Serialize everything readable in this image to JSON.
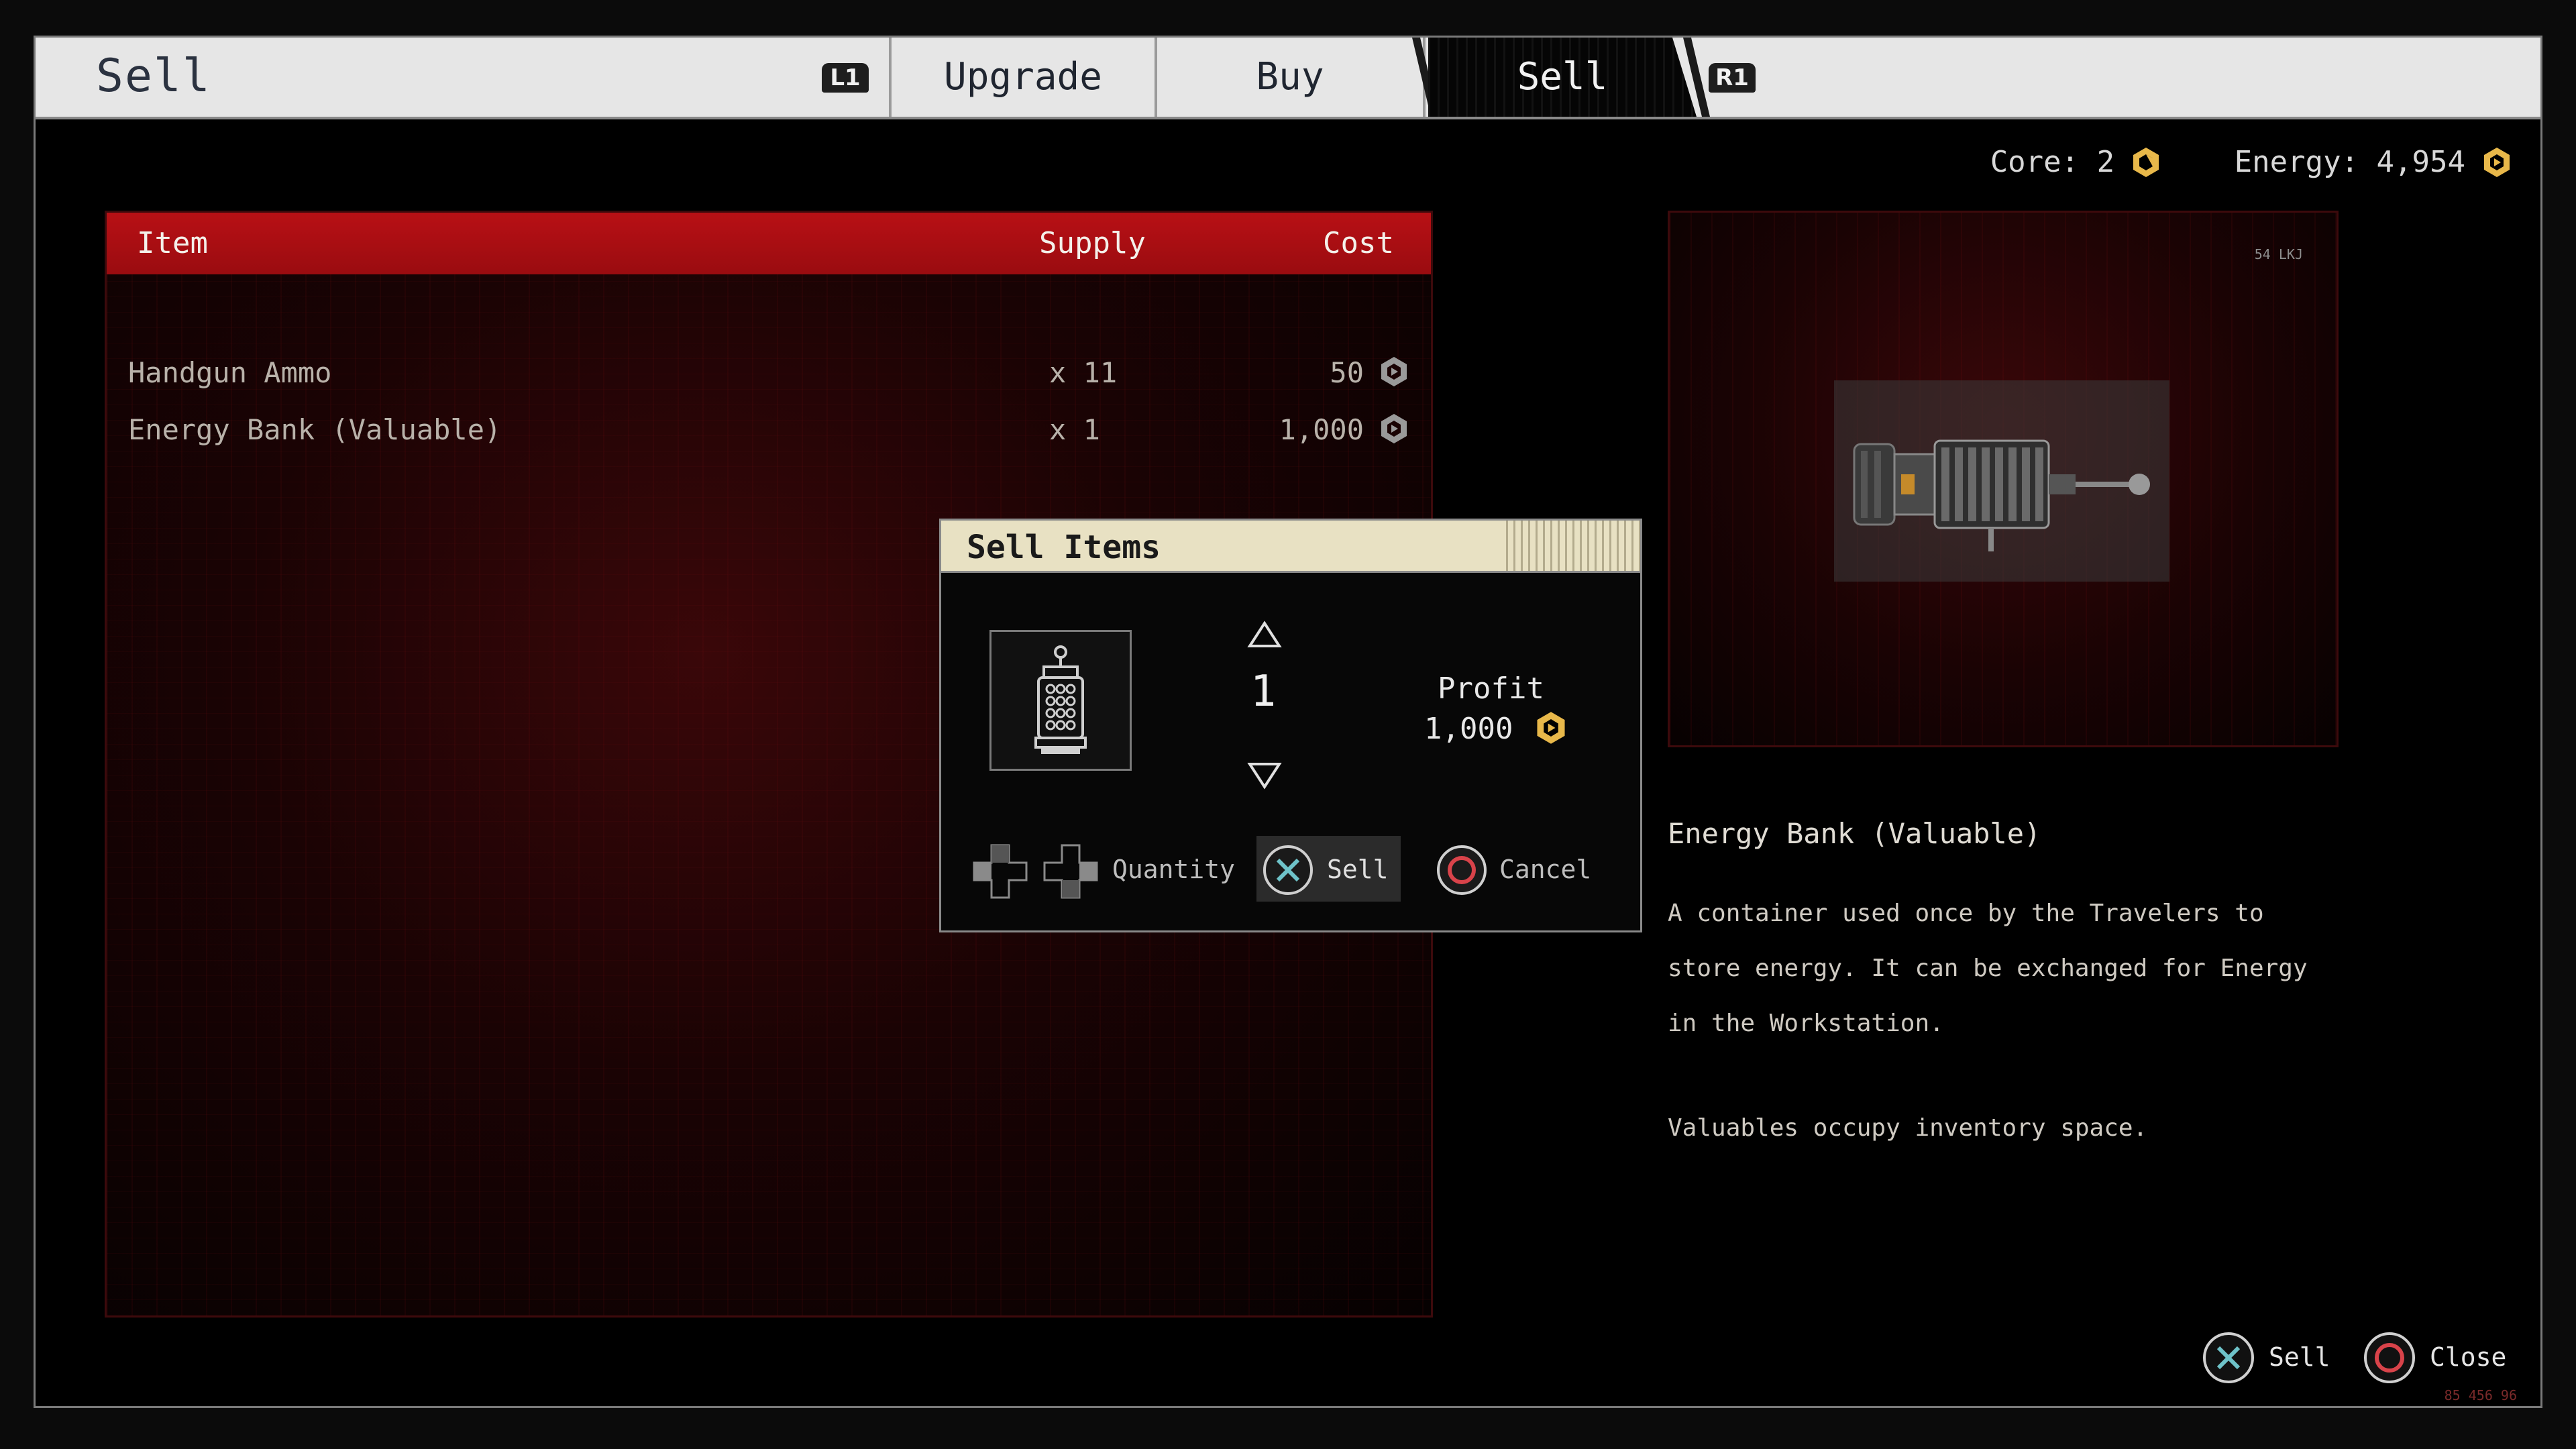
{
  "header": {
    "title": "Sell",
    "l1_glyph": "L1",
    "r1_glyph": "R1",
    "tabs": [
      {
        "label": "Upgrade",
        "active": false
      },
      {
        "label": "Buy",
        "active": false
      },
      {
        "label": "Sell",
        "active": true
      }
    ]
  },
  "currency": {
    "core_label": "Core: 2",
    "energy_label": "Energy: 4,954"
  },
  "list": {
    "columns": {
      "item": "Item",
      "supply": "Supply",
      "cost": "Cost"
    },
    "rows": [
      {
        "name": "Handgun Ammo",
        "supply": "x 11",
        "cost": "50"
      },
      {
        "name": "Energy Bank (Valuable)",
        "supply": "x 1",
        "cost": "1,000"
      }
    ]
  },
  "dialog": {
    "title": "Sell Items",
    "quantity": "1",
    "profit_label": "Profit",
    "profit_value": "1,000",
    "quantity_hint": "Quantity",
    "sell_label": "Sell",
    "cancel_label": "Cancel"
  },
  "preview": {
    "code": "54 LKJ",
    "item_title": "Energy Bank (Valuable)",
    "description": "A container used once by the Travelers to store energy. It can be exchanged for Energy in the Workstation.",
    "note": "Valuables occupy inventory space."
  },
  "prompts": {
    "sell": "Sell",
    "close": "Close",
    "corner_code": "85 456 96"
  },
  "colors": {
    "header_red": "#b81015",
    "dialog_header": "#e8e1c3",
    "cross_button": "#6ec3c9",
    "circle_button": "#d9434a",
    "energy_icon": "#e8b84a"
  },
  "icons": {
    "core": "hexagon-core-icon",
    "energy": "hexagon-energy-icon",
    "cross": "cross-button-icon",
    "circle": "circle-button-icon",
    "dpad": "dpad-icon"
  }
}
